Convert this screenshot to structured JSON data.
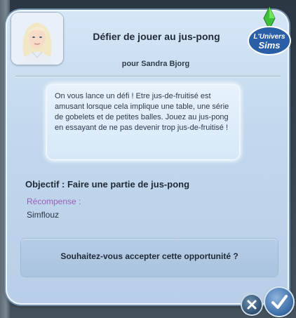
{
  "dialog": {
    "title": "Défier de jouer au jus-pong",
    "subtitle": "pour Sandra Bjorg",
    "message": "On vous lance un défi ! Etre jus-de-fruitisé est amusant lorsque cela implique une table, une série de gobelets et de petites balles. Jouez au jus-pong en essayant de ne pas devenir trop jus-de-fruitisé !",
    "objective": "Objectif : Faire une partie de jus-pong",
    "reward_label": "Récompense :",
    "reward_value": "Simflouz",
    "question": "Souhaitez-vous accepter cette opportunité ?"
  },
  "logo": {
    "line1": "L'Univers",
    "line2": "Sims"
  },
  "buttons": {
    "cancel_icon": "close-icon",
    "accept_icon": "checkmark-icon"
  },
  "colors": {
    "panel": "#c2d8ee",
    "reward_label": "#9b5fb8",
    "accept_button": "#3d6fa8"
  }
}
